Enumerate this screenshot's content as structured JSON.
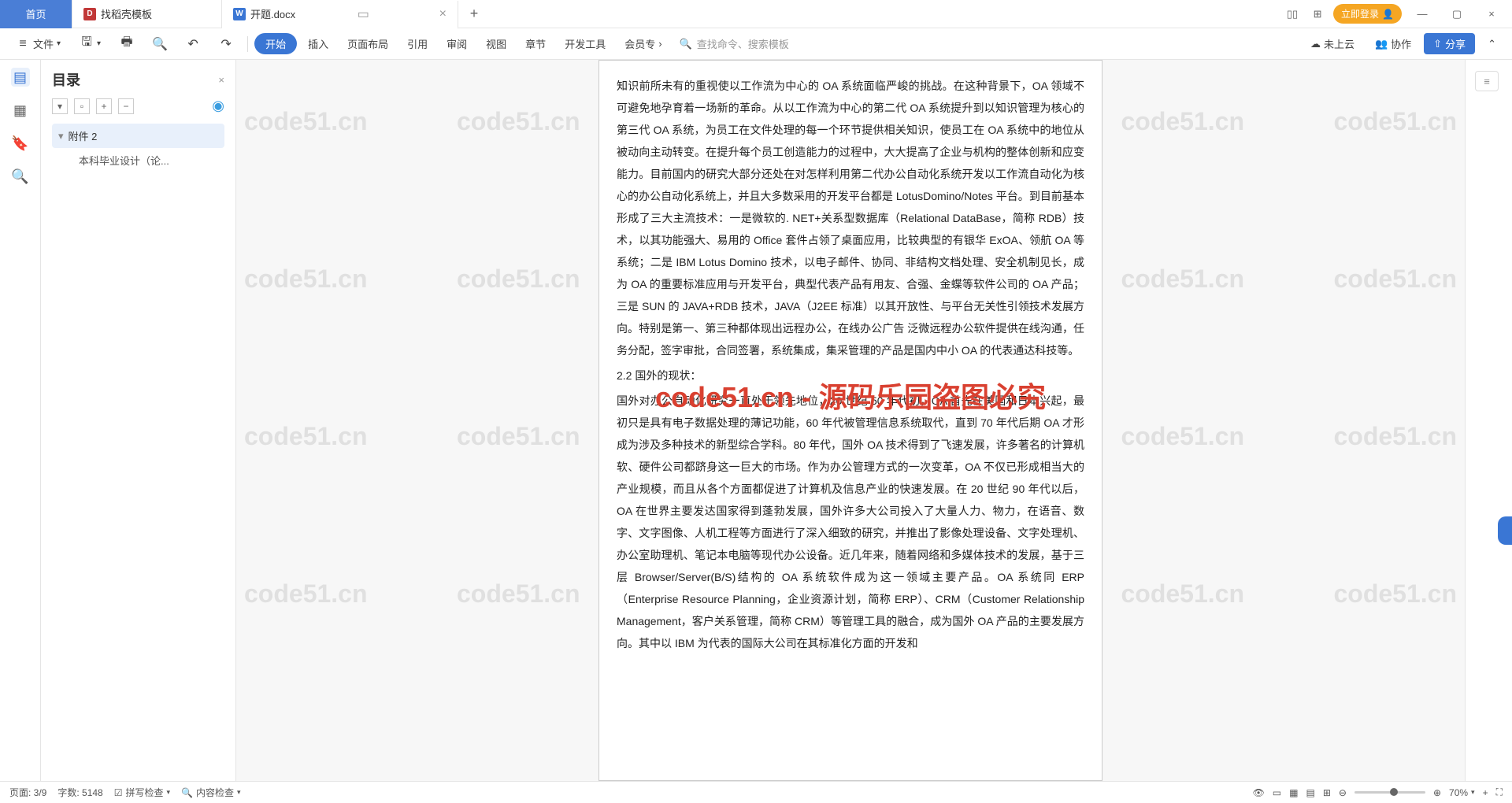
{
  "tabs": {
    "home": "首页",
    "template": "找稻壳模板",
    "doc": "开题.docx"
  },
  "titlebar": {
    "login": "立即登录"
  },
  "ribbon": {
    "file": "文件",
    "start": "开始",
    "insert": "插入",
    "pagelayout": "页面布局",
    "reference": "引用",
    "review": "审阅",
    "view": "视图",
    "chapter": "章节",
    "devtools": "开发工具",
    "member": "会员专",
    "search": "查找命令、搜索模板",
    "notcloud": "未上云",
    "collab": "协作",
    "share": "分享"
  },
  "outline": {
    "title": "目录",
    "item1": "附件 2",
    "item2": "本科毕业设计（论..."
  },
  "doc": {
    "p1": "知识前所未有的重视使以工作流为中心的 OA 系统面临严峻的挑战。在这种背景下，OA 领域不可避免地孕育着一场新的革命。从以工作流为中心的第二代 OA 系统提升到以知识管理为核心的第三代 OA 系统，为员工在文件处理的每一个环节提供相关知识，使员工在 OA 系统中的地位从被动向主动转变。在提升每个员工创造能力的过程中，大大提高了企业与机构的整体创新和应变能力。目前国内的研究大部分还处在对怎样利用第二代办公自动化系统开发以工作流自动化为核心的办公自动化系统上，并且大多数采用的开发平台都是 LotusDomino/Notes 平台。到目前基本形成了三大主流技术：一是微软的. NET+关系型数据库（Relational DataBase，简称 RDB）技术，以其功能强大、易用的 Office 套件占领了桌面应用，比较典型的有银华 ExOA、领航 OA 等系统；二是 IBM Lotus Domino 技术，以电子邮件、协同、非结构文档处理、安全机制见长，成为 OA 的重要标准应用与开发平台，典型代表产品有用友、合强、金蝶等软件公司的 OA 产品；三是 SUN 的 JAVA+RDB 技术，JAVA（J2EE 标准）以其开放性、与平台无关性引领技术发展方向。特别是第一、第三种都体现出远程办公，在线办公广告 泛微远程办公软件提供在线沟通，任务分配，签字审批，合同签署，系统集成，集采管理的产品是国内中小 OA 的代表通达科技等。",
    "p2": "2.2 国外的现状：",
    "p3": "国外对办公自动化研究一直处于领先地位，20 世纪 50 年代初，OA 首先在美国和日本兴起，最初只是具有电子数据处理的薄记功能，60 年代被管理信息系统取代，直到 70 年代后期 OA 才形成为涉及多种技术的新型综合学科。80 年代，国外 OA 技术得到了飞速发展，许多著名的计算机软、硬件公司都跻身这一巨大的市场。作为办公管理方式的一次变革，OA 不仅已形成相当大的产业规模，而且从各个方面都促进了计算机及信息产业的快速发展。在 20 世纪 90 年代以后，OA 在世界主要发达国家得到蓬勃发展，国外许多大公司投入了大量人力、物力，在语音、数字、文字图像、人机工程等方面进行了深入细致的研究，并推出了影像处理设备、文字处理机、办公室助理机、笔记本电脑等现代办公设备。近几年来，随着网络和多媒体技术的发展，基于三层 Browser/Server(B/S)结构的 OA 系统软件成为这一领域主要产品。OA 系统同 ERP（Enterprise Resource Planning，企业资源计划，简称 ERP）、CRM（Customer Relationship Management，客户关系管理，简称 CRM）等管理工具的融合，成为国外 OA 产品的主要发展方向。其中以 IBM 为代表的国际大公司在其标准化方面的开发和"
  },
  "watermark": {
    "text": "code51.cn",
    "red": "code51.cn - 源码乐园盗图必究"
  },
  "statusbar": {
    "page": "页面: 3/9",
    "words": "字数: 5148",
    "spell": "拼写检查",
    "content": "内容检查",
    "zoom": "70%"
  }
}
